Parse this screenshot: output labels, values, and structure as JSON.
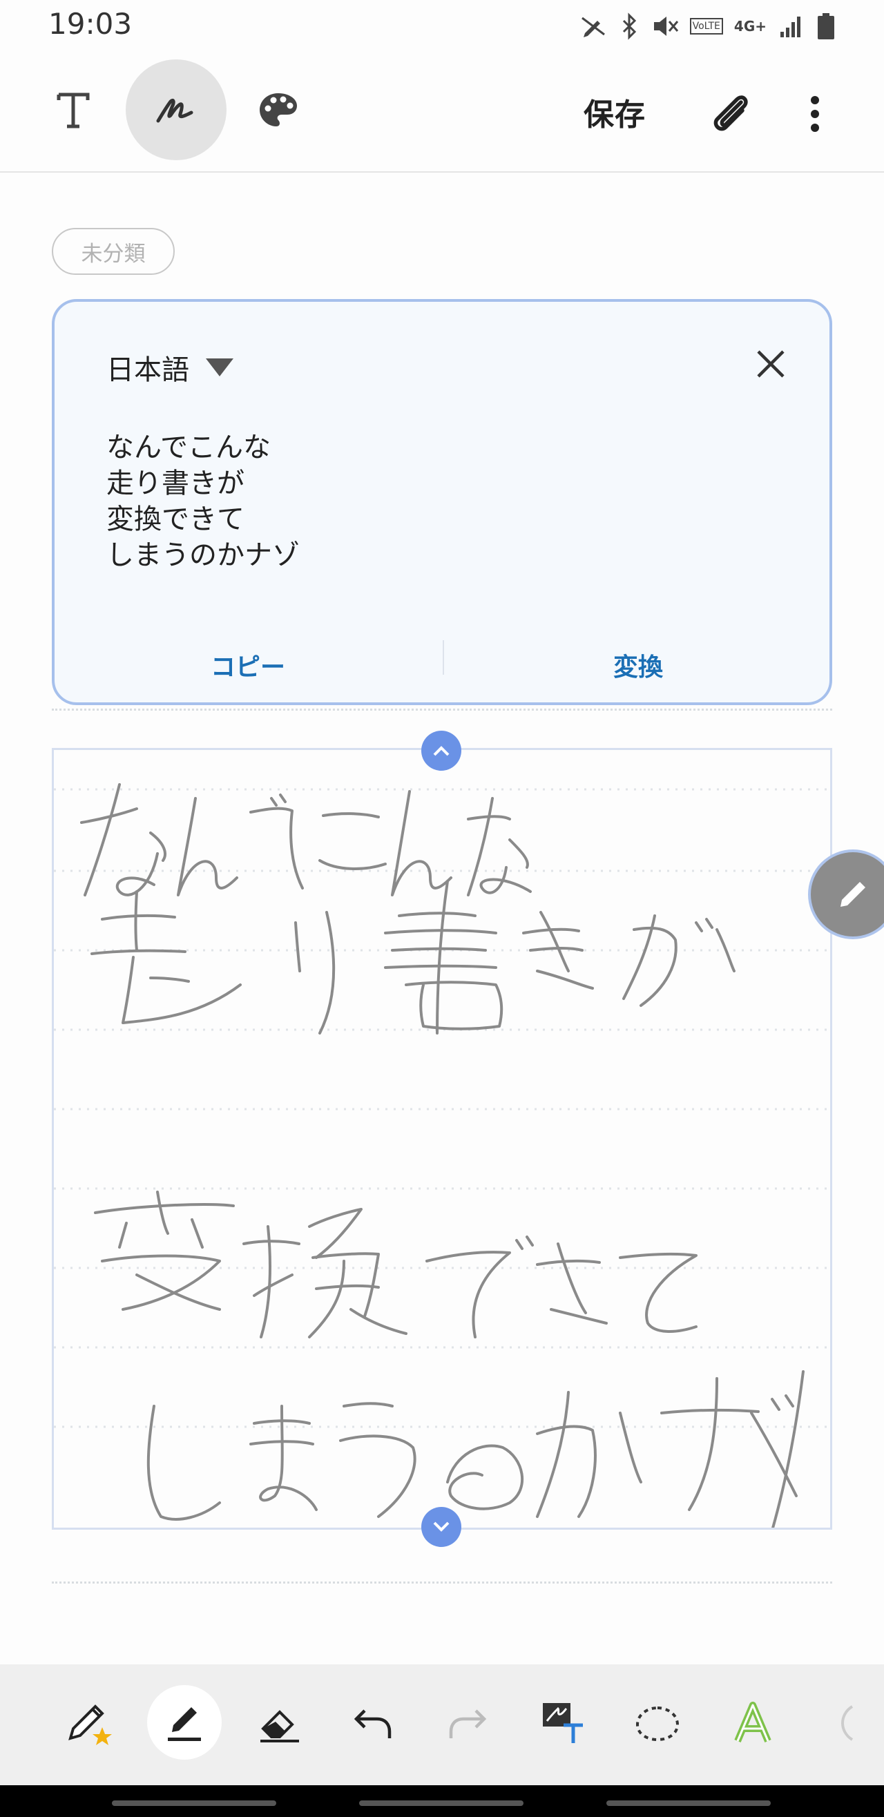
{
  "status_bar": {
    "time": "19:03",
    "volte": "VoLTE",
    "network": "4G+",
    "icons": [
      "pen-no-icon",
      "bluetooth-icon",
      "mute-icon",
      "signal-icon",
      "battery-icon"
    ]
  },
  "toolbar": {
    "save_label": "保存",
    "icons": [
      "text-mode-icon",
      "pen-mode-icon",
      "palette-icon",
      "attach-icon",
      "more-icon"
    ]
  },
  "category": {
    "label": "未分類"
  },
  "recognition": {
    "language": "日本語",
    "lines": [
      "なんでこんな",
      "走り書きが",
      "変換できて",
      "しまうのかナゾ"
    ],
    "copy_label": "コピー",
    "convert_label": "変換"
  },
  "colors": {
    "accent": "#1b6fb5",
    "card_border": "#a6c0ec",
    "handle": "#6a92e6",
    "ink": "#8a8a8a"
  },
  "bottom_tools": {
    "items": [
      "pen-favorite-icon",
      "pen-icon",
      "eraser-icon",
      "undo-icon",
      "redo-icon",
      "handwriting-to-text-icon",
      "lasso-icon",
      "highlighter-icon",
      "more-tools-icon"
    ]
  }
}
